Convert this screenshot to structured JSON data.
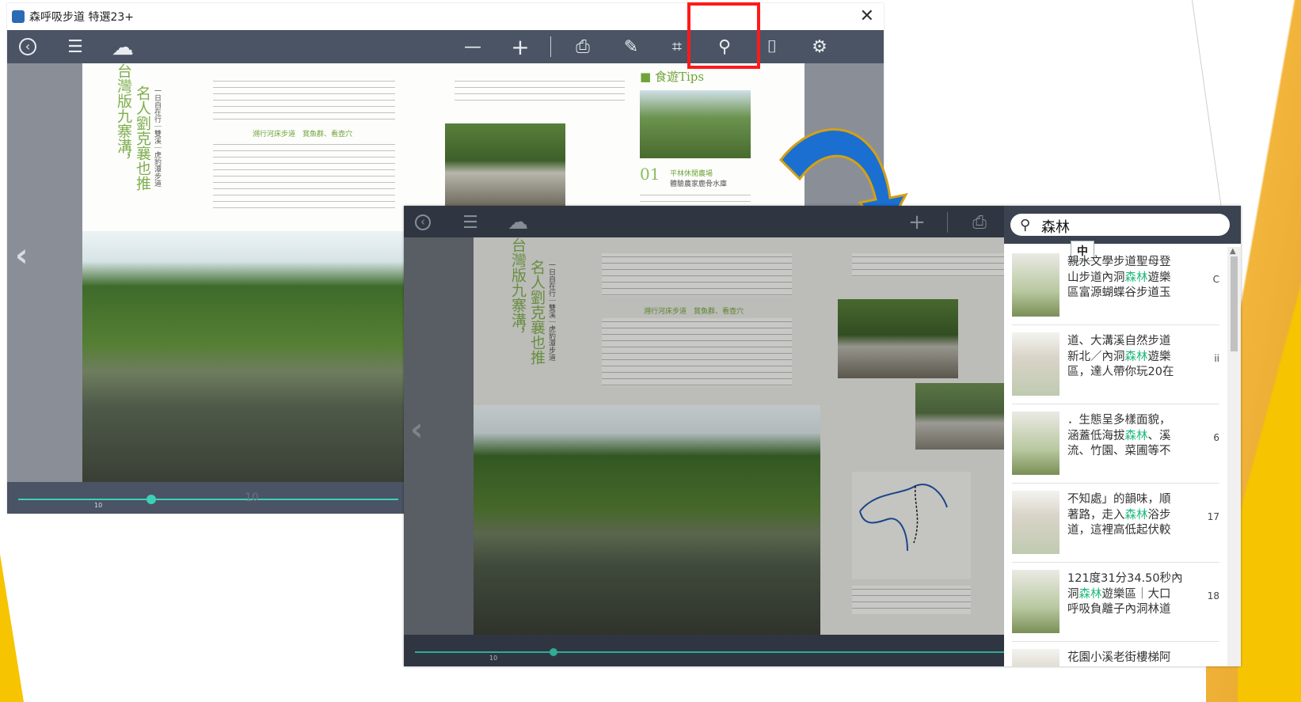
{
  "window1": {
    "title": "森呼吸步道 特選23+",
    "close_glyph": "✕",
    "toolbar": {
      "back_glyph": "‹",
      "menu_glyph": "☰",
      "cloud_glyph": "☁",
      "zoom_out_glyph": "—",
      "zoom_in_glyph": "+",
      "print_glyph": "⎙",
      "pen_glyph": "✎",
      "crop_glyph": "⌗",
      "search_glyph": "⚲",
      "bookmark_glyph": "⌷",
      "settings_glyph": "⚙"
    },
    "nav": {
      "prev_glyph": "‹"
    },
    "page": {
      "vertical_title": "台灣版九寨溝，",
      "vertical_title2": "名人劉克襄也推",
      "vertical_sub": "一日自在行｜雙溪｜虎豹潭步道",
      "tips_heading": "■ 食遊Tips",
      "section_heading": "溯行河床步道　賞魚群、看壺穴",
      "tip_number": "01",
      "tip_title": "平林休閒農場",
      "tip_subtitle": "體驗農家鹿骨水庫"
    },
    "slider": {
      "label": "10",
      "value": 0.35,
      "page_label": "10"
    }
  },
  "window2": {
    "search": {
      "query": "森林",
      "search_glyph": "⚲",
      "ime_indicator": "中"
    },
    "results": [
      {
        "before": "親水文學步道聖母登\n山步道內洞",
        "match": "森林",
        "after": "遊樂\n區富源蝴蝶谷步道玉",
        "page": "C"
      },
      {
        "before": "道、大溝溪自然步道\n新北／內洞",
        "match": "森林",
        "after": "遊樂\n區，達人帶你玩20在",
        "page": "ii"
      },
      {
        "before": "．生態呈多樣面貌，\n涵蓋低海拔",
        "match": "森林",
        "after": "、溪\n流、竹園、菜圃等不",
        "page": "6"
      },
      {
        "before": "不知處」的韻味，順\n著路，走入",
        "match": "森林",
        "after": "浴步\n道，這裡高低起伏較",
        "page": "17"
      },
      {
        "before": "121度31分34.50秒內\n洞",
        "match": "森林",
        "after": "遊樂區｜大口\n呼吸負離子內洞林道",
        "page": "18"
      },
      {
        "before": "花園小溪老街樓梯阿",
        "match": "",
        "after": "",
        "page": ""
      }
    ],
    "scroll_up_glyph": "▲"
  },
  "colors": {
    "toolbar": "#4a5464",
    "accent_green": "#1db97a",
    "slider": "#3ad1b7",
    "highlight_red": "#ff1a1a",
    "arrow_blue": "#1a6fd1",
    "arrow_outline": "#d4a017"
  }
}
